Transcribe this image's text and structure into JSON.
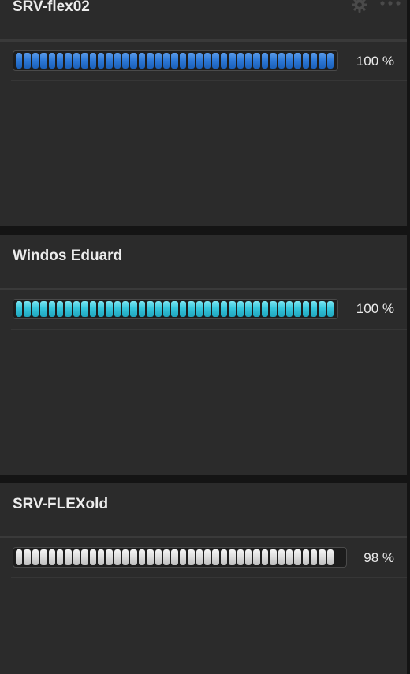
{
  "panels": [
    {
      "title": "SRV-flex02",
      "percent_text": "100 %",
      "fill": 1.0,
      "bar_color": "#2f7ad8",
      "color_class": "blue",
      "icons": [
        "gear-icon",
        "more-icon"
      ]
    },
    {
      "title": "Windos Eduard",
      "percent_text": "100 %",
      "fill": 1.0,
      "bar_color": "#36c6dc",
      "color_class": "cyan"
    },
    {
      "title": "SRV-FLEXold",
      "percent_text": "98 %",
      "fill": 0.98,
      "bar_color": "#dcdcdc",
      "color_class": "white"
    }
  ]
}
